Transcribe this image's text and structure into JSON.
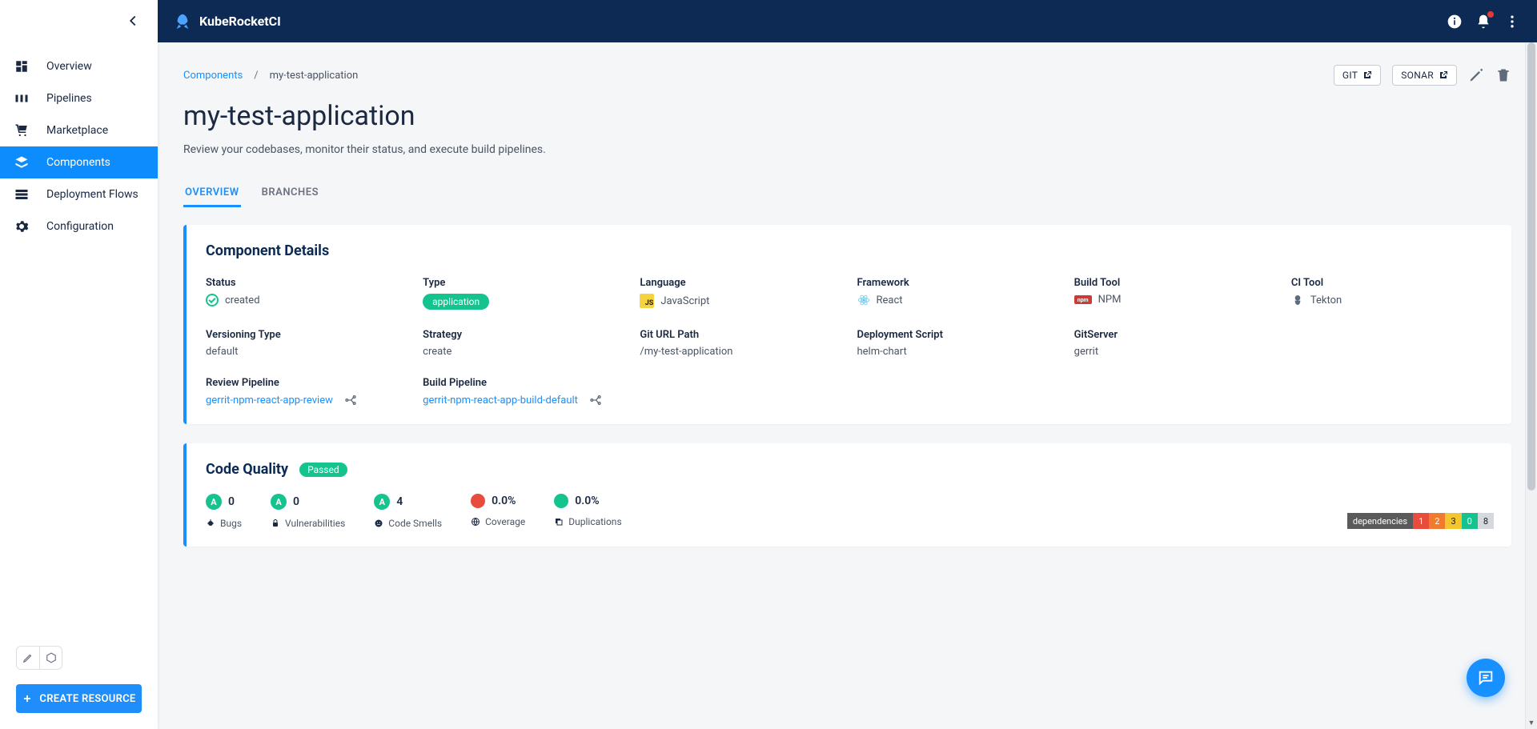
{
  "app": {
    "name": "KubeRocketCI"
  },
  "sidebar": {
    "items": [
      {
        "label": "Overview"
      },
      {
        "label": "Pipelines"
      },
      {
        "label": "Marketplace"
      },
      {
        "label": "Components"
      },
      {
        "label": "Deployment Flows"
      },
      {
        "label": "Configuration"
      }
    ],
    "create_label": "CREATE RESOURCE"
  },
  "breadcrumb": {
    "root": "Components",
    "current": "my-test-application"
  },
  "actions": {
    "git": "GIT",
    "sonar": "SONAR"
  },
  "page": {
    "title": "my-test-application",
    "subtitle": "Review your codebases, monitor their status, and execute build pipelines."
  },
  "tabs": [
    {
      "label": "OVERVIEW",
      "active": true
    },
    {
      "label": "BRANCHES",
      "active": false
    }
  ],
  "details": {
    "heading": "Component Details",
    "status_label": "Status",
    "status_value": "created",
    "type_label": "Type",
    "type_value": "application",
    "language_label": "Language",
    "language_value": "JavaScript",
    "framework_label": "Framework",
    "framework_value": "React",
    "buildtool_label": "Build Tool",
    "buildtool_value": "NPM",
    "citool_label": "CI Tool",
    "citool_value": "Tekton",
    "versioning_label": "Versioning Type",
    "versioning_value": "default",
    "strategy_label": "Strategy",
    "strategy_value": "create",
    "giturl_label": "Git URL Path",
    "giturl_value": "/my-test-application",
    "deployscript_label": "Deployment Script",
    "deployscript_value": "helm-chart",
    "gitserver_label": "GitServer",
    "gitserver_value": "gerrit",
    "review_label": "Review Pipeline",
    "review_value": "gerrit-npm-react-app-review",
    "build_label": "Build Pipeline",
    "build_value": "gerrit-npm-react-app-build-default"
  },
  "quality": {
    "heading": "Code Quality",
    "status": "Passed",
    "bugs": {
      "grade": "A",
      "value": "0",
      "label": "Bugs"
    },
    "vuln": {
      "grade": "A",
      "value": "0",
      "label": "Vulnerabilities"
    },
    "smells": {
      "grade": "A",
      "value": "4",
      "label": "Code Smells"
    },
    "coverage": {
      "value": "0.0%",
      "label": "Coverage"
    },
    "dup": {
      "value": "0.0%",
      "label": "Duplications"
    },
    "deps": {
      "label": "dependencies",
      "c1": "1",
      "c2": "2",
      "c3": "3",
      "c4": "0",
      "c5": "8"
    }
  }
}
